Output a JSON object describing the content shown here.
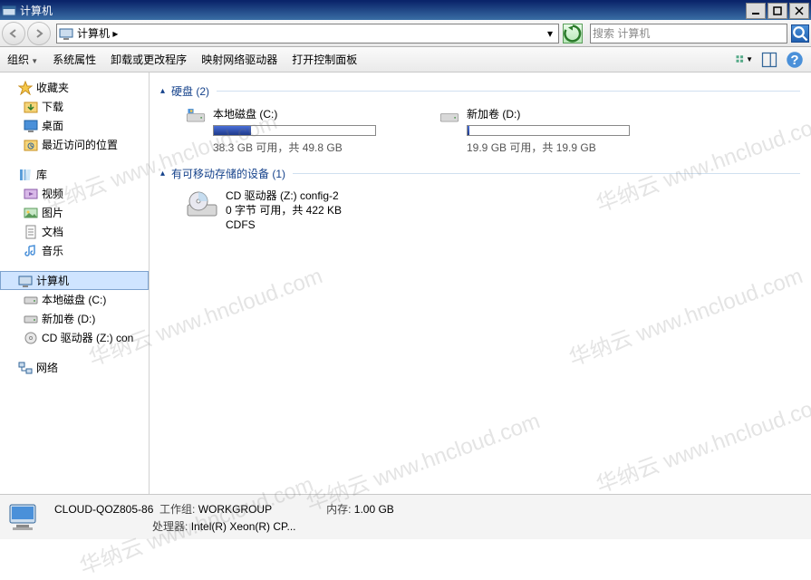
{
  "window": {
    "title": "计算机"
  },
  "nav": {
    "breadcrumb": "计算机 ▸",
    "search_placeholder": "搜索 计算机"
  },
  "toolbar": {
    "organize": "组织",
    "system_props": "系统属性",
    "uninstall": "卸载或更改程序",
    "map_drive": "映射网络驱动器",
    "control_panel": "打开控制面板"
  },
  "sidebar": {
    "favorites": {
      "label": "收藏夹",
      "items": [
        "下载",
        "桌面",
        "最近访问的位置"
      ]
    },
    "libraries": {
      "label": "库",
      "items": [
        "视频",
        "图片",
        "文档",
        "音乐"
      ]
    },
    "computer": {
      "label": "计算机",
      "items": [
        "本地磁盘 (C:)",
        "新加卷 (D:)",
        "CD 驱动器 (Z:) con"
      ]
    },
    "network": {
      "label": "网络"
    }
  },
  "content": {
    "hdd_group": "硬盘 (2)",
    "removable_group": "有可移动存储的设备 (1)",
    "drives": [
      {
        "name": "本地磁盘 (C:)",
        "stats": "38.3 GB 可用，共 49.8 GB",
        "fill_pct": 23
      },
      {
        "name": "新加卷 (D:)",
        "stats": "19.9 GB 可用，共 19.9 GB",
        "fill_pct": 1
      }
    ],
    "removable": {
      "line1": "CD 驱动器 (Z:) config-2",
      "line2": "0 字节 可用，共 422 KB",
      "line3": "CDFS"
    }
  },
  "status": {
    "host": "CLOUD-QOZ805-86",
    "workgroup_label": "工作组:",
    "workgroup": "WORKGROUP",
    "memory_label": "内存:",
    "memory": "1.00 GB",
    "cpu_label": "处理器:",
    "cpu": "Intel(R) Xeon(R) CP..."
  },
  "watermark": "华纳云 www.hncloud.com"
}
